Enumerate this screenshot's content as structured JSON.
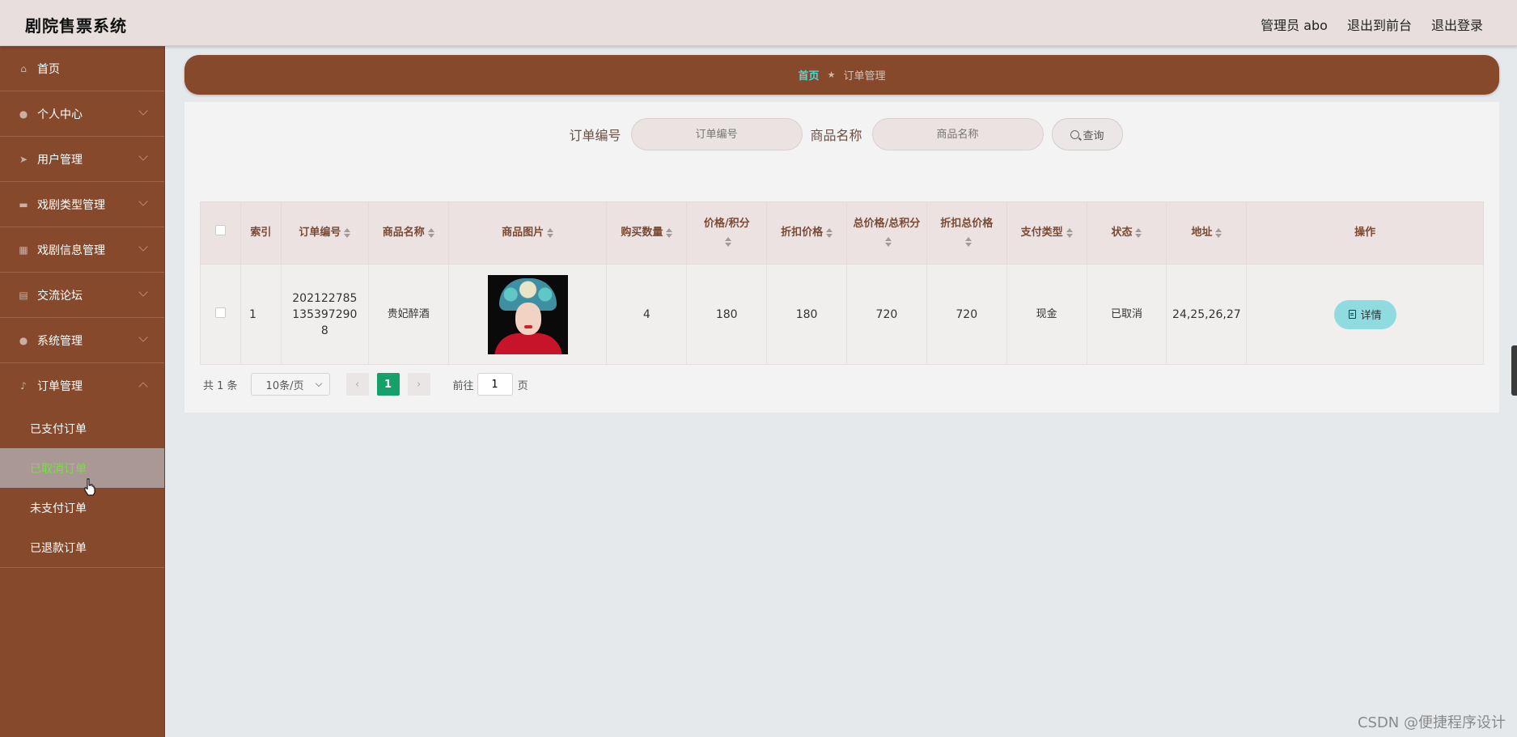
{
  "app": {
    "title": "剧院售票系统"
  },
  "topnav": {
    "user": "管理员 abo",
    "to_front": "退出到前台",
    "logout": "退出登录"
  },
  "sidebar": {
    "items": [
      {
        "label": "首页",
        "icon": "home-icon"
      },
      {
        "label": "个人中心",
        "icon": "user-icon"
      },
      {
        "label": "用户管理",
        "icon": "send-icon"
      },
      {
        "label": "戏剧类型管理",
        "icon": "briefcase-icon"
      },
      {
        "label": "戏剧信息管理",
        "icon": "calendar-icon"
      },
      {
        "label": "交流论坛",
        "icon": "forum-icon"
      },
      {
        "label": "系统管理",
        "icon": "settings-user-icon"
      },
      {
        "label": "订单管理",
        "icon": "microphone-icon"
      }
    ],
    "order_sub": [
      {
        "label": "已支付订单"
      },
      {
        "label": "已取消订单"
      },
      {
        "label": "未支付订单"
      },
      {
        "label": "已退款订单"
      }
    ]
  },
  "breadcrumb": {
    "home": "首页",
    "separator": "★",
    "current": "订单管理"
  },
  "search": {
    "order_no_label": "订单编号",
    "order_no_placeholder": "订单编号",
    "product_label": "商品名称",
    "product_placeholder": "商品名称",
    "query_label": "查询"
  },
  "table": {
    "headers": {
      "index": "索引",
      "order_no": "订单编号",
      "product_name": "商品名称",
      "product_image": "商品图片",
      "quantity": "购买数量",
      "price": "价格/积分",
      "discount_price": "折扣价格",
      "total": "总价格/总积分",
      "discount_total": "折扣总价格",
      "pay_type": "支付类型",
      "status": "状态",
      "address": "地址",
      "actions": "操作"
    },
    "rows": [
      {
        "index": "1",
        "order_no": "2021227851353972908",
        "product_name": "贵妃醉酒",
        "quantity": "4",
        "price": "180",
        "discount_price": "180",
        "total": "720",
        "discount_total": "720",
        "pay_type": "现金",
        "status": "已取消",
        "address": "24,25,26,27",
        "detail_label": "详情"
      }
    ]
  },
  "pagination": {
    "total": "共 1 条",
    "page_size": "10条/页",
    "current_page": "1",
    "goto_label": "前往",
    "goto_value": "1",
    "goto_suffix": "页"
  },
  "watermark": "CSDN @便捷程序设计",
  "colors": {
    "sidebar": "#86492c",
    "accent": "#16a06a",
    "detail_button": "#8fdbe0",
    "active_text": "#7cdc4a"
  }
}
